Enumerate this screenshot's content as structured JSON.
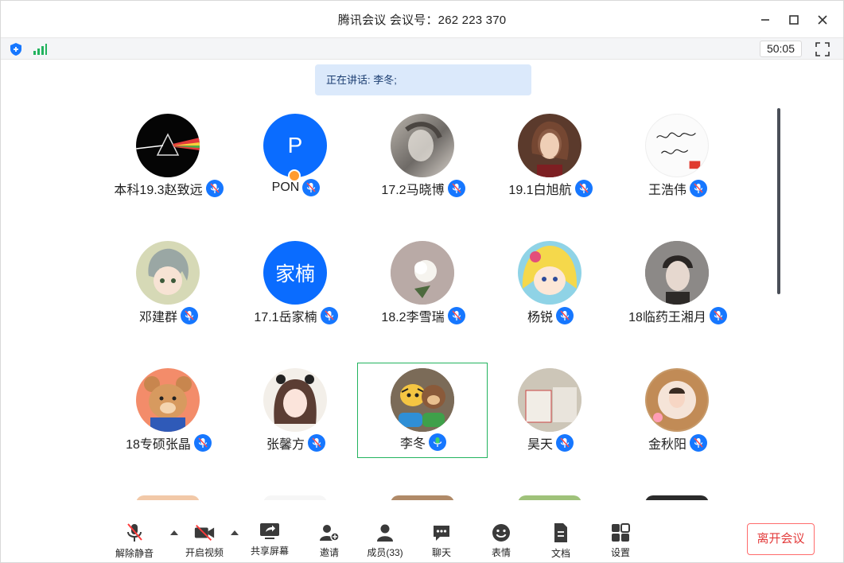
{
  "window": {
    "title": "腾讯会议 会议号：262 223 370"
  },
  "info": {
    "timer": "50:05"
  },
  "speaking": {
    "text": "正在讲话: 李冬;"
  },
  "participants": [
    {
      "name": "本科19.3赵致远"
    },
    {
      "name": "PON",
      "avatar_text": "P",
      "host": true
    },
    {
      "name": "17.2马晓博"
    },
    {
      "name": "19.1白旭航"
    },
    {
      "name": "王浩伟"
    },
    {
      "name": "邓建群"
    },
    {
      "name": "17.1岳家楠",
      "avatar_text": "家楠"
    },
    {
      "name": "18.2李雪瑞"
    },
    {
      "name": "杨锐"
    },
    {
      "name": "18临药王湘月"
    },
    {
      "name": "18专硕张晶"
    },
    {
      "name": "张馨方"
    },
    {
      "name": "李冬",
      "active": true
    },
    {
      "name": "昊天"
    },
    {
      "name": "金秋阳"
    }
  ],
  "toolbar": {
    "unmute": "解除静音",
    "video": "开启视频",
    "share": "共享屏幕",
    "invite": "邀请",
    "members": "成员(33)",
    "chat": "聊天",
    "reactions": "表情",
    "docs": "文档",
    "settings": "设置",
    "leave": "离开会议"
  },
  "colors": {
    "accent": "#1677ff",
    "speaking_border": "#22b35e",
    "leave": "#e33b3b",
    "banner": "#dbe9fb"
  }
}
